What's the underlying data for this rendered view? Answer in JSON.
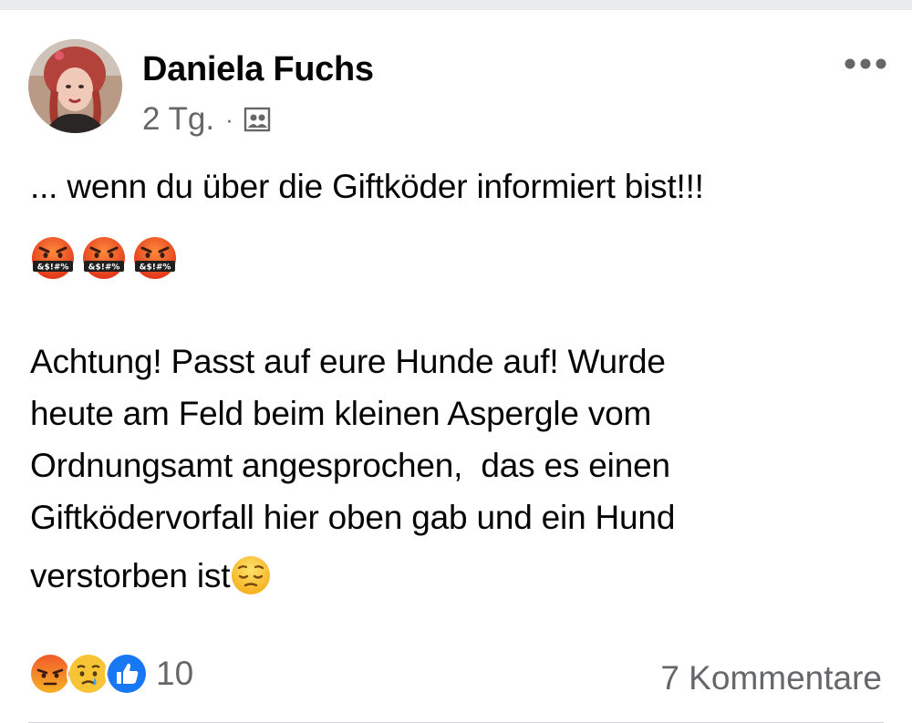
{
  "post": {
    "author": "Daniela Fuchs",
    "time": "2 Tg.",
    "separator": "·",
    "audience_icon": "group-icon",
    "more_icon": "more-horizontal-icon",
    "headline": "... wenn du über die Giftköder informiert bist!!!",
    "cursing_emojis": [
      "face-with-symbols-on-mouth",
      "face-with-symbols-on-mouth",
      "face-with-symbols-on-mouth"
    ],
    "cursing_text": "&$!#%",
    "body_lines": [
      "Achtung! Passt auf eure Hunde auf! Wurde",
      "heute am Feld beim kleinen Aspergle vom",
      "Ordnungsamt angesprochen,  das es einen",
      "Giftködervorfall hier oben gab und ein Hund",
      "verstorben ist"
    ],
    "trailing_emoji": "pensive-face"
  },
  "footer": {
    "reaction_icons": [
      "angry-icon",
      "sad-icon",
      "like-icon"
    ],
    "reaction_count": "10",
    "comments": "7 Kommentare"
  },
  "colors": {
    "text": "#050505",
    "secondary": "#65676b",
    "like_blue": "#1877f2",
    "divider": "#ced0d4"
  }
}
